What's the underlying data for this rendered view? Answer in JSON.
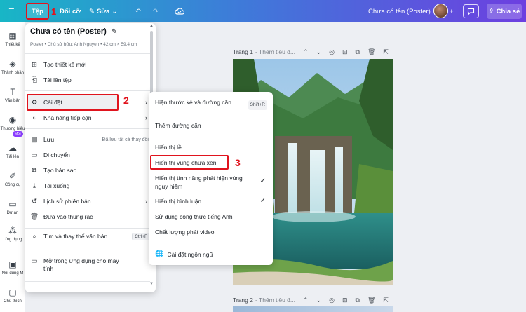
{
  "topbar": {
    "menu_icon": "hamburger-icon",
    "file_label": "Tệp",
    "step1": "1",
    "resize_label": "Đổi cỡ",
    "edit_label": "Sửa",
    "undo_icon": "undo-icon",
    "redo_icon": "redo-icon",
    "cloud_icon": "cloud-sync-icon",
    "doc_title": "Chưa có tên (Poster)",
    "share_label": "Chia sẻ"
  },
  "sidebar": {
    "items": [
      {
        "label": "Thiết kế",
        "icon": "layout-icon"
      },
      {
        "label": "Thành phần",
        "icon": "shapes-icon"
      },
      {
        "label": "Văn bản",
        "icon": "text-icon"
      },
      {
        "label": "Thương hiệu",
        "icon": "brand-icon"
      },
      {
        "label": "Tải lên",
        "icon": "cloud-upload-icon"
      },
      {
        "label": "Công cụ",
        "icon": "draw-icon"
      },
      {
        "label": "Dự án",
        "icon": "folder-icon"
      },
      {
        "label": "Ứng dụng",
        "icon": "apps-icon"
      },
      {
        "label": "Nội dung M",
        "icon": "photo-icon"
      },
      {
        "label": "Chú thích",
        "icon": "comment-icon"
      }
    ],
    "new_badge": "Mới"
  },
  "file_menu": {
    "title": "Chưa có tên (Poster)",
    "meta": "Poster • Chủ sở hữu: Anh Nguyen • 42 cm × 59.4 cm",
    "items": [
      {
        "label": "Tạo thiết kế mới",
        "icon": "add-design-icon"
      },
      {
        "label": "Tải lên tệp",
        "icon": "upload-file-icon"
      },
      {
        "label": "Cài đặt",
        "icon": "settings-gear-icon"
      },
      {
        "label": "Khả năng tiếp cận",
        "icon": "accessibility-icon"
      },
      {
        "label": "Lưu",
        "icon": "save-icon",
        "right": "Đã lưu tất cả thay đổi"
      },
      {
        "label": "Di chuyển",
        "icon": "move-folder-icon"
      },
      {
        "label": "Tạo bản sao",
        "icon": "copy-icon"
      },
      {
        "label": "Tải xuống",
        "icon": "download-icon"
      },
      {
        "label": "Lịch sử phiên bản",
        "icon": "history-icon"
      },
      {
        "label": "Đưa vào thùng rác",
        "icon": "trash-icon"
      },
      {
        "label": "Tìm và thay thế văn bản",
        "icon": "search-icon",
        "shortcut": "Ctrl+F"
      },
      {
        "label": "Mở trong ứng dụng cho máy tính",
        "icon": "desktop-icon"
      }
    ],
    "step2": "2"
  },
  "settings_submenu": {
    "items": [
      {
        "label": "Hiện thước kẻ và đường căn",
        "shortcut": "Shift+R"
      },
      {
        "label": "Thêm đường căn"
      },
      {
        "label": "Hiển thị lề"
      },
      {
        "label": "Hiển thị vùng chứa xén"
      },
      {
        "label": "Hiển thị tính năng phát hiện vùng nguy hiểm",
        "checked": true
      },
      {
        "label": "Hiển thị bình luận",
        "checked": true
      },
      {
        "label": "Sử dụng công thức tiếng Anh"
      },
      {
        "label": "Chất lượng phát video"
      },
      {
        "label": "Cài đặt ngôn ngữ",
        "icon": "globe-icon"
      }
    ],
    "step3": "3"
  },
  "pages": {
    "page1_label": "Trang 1",
    "page1_sub": "- Thêm tiêu đ...",
    "page2_label": "Trang 2",
    "page2_sub": "- Thêm tiêu đ..."
  }
}
